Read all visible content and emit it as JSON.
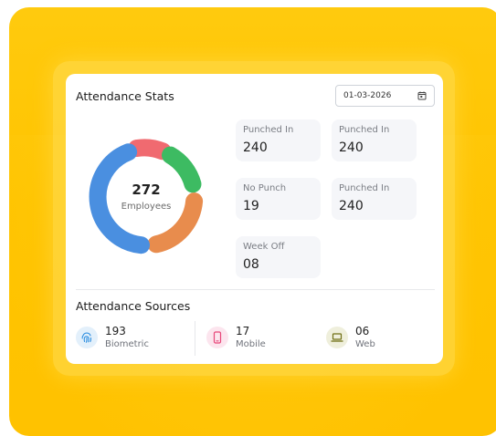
{
  "card": {
    "title": "Attendance Stats",
    "date_value": "01-03-2026"
  },
  "donut": {
    "total": "272",
    "total_label": "Employees",
    "segments": [
      {
        "name": "red",
        "color": "#f06a70"
      },
      {
        "name": "green",
        "color": "#3dbb62"
      },
      {
        "name": "orange",
        "color": "#e88c4d"
      },
      {
        "name": "blue",
        "color": "#4a8fe0"
      }
    ]
  },
  "stats": [
    {
      "label": "Punched In",
      "value": "240"
    },
    {
      "label": "Punched In",
      "value": "240"
    },
    {
      "label": "No Punch",
      "value": "19"
    },
    {
      "label": "Punched In",
      "value": "240"
    },
    {
      "label": "Week Off",
      "value": "08"
    }
  ],
  "sources": {
    "title": "Attendance Sources",
    "items": [
      {
        "value": "193",
        "label": "Biometric",
        "icon": "fingerprint-icon",
        "color": "#2f8fe0",
        "bg": "#e3f0fb"
      },
      {
        "value": "17",
        "label": "Mobile",
        "icon": "mobile-icon",
        "color": "#e8477a",
        "bg": "#fce5ee"
      },
      {
        "value": "06",
        "label": "Web",
        "icon": "laptop-icon",
        "color": "#7a7a1a",
        "bg": "#efefdc"
      }
    ]
  }
}
